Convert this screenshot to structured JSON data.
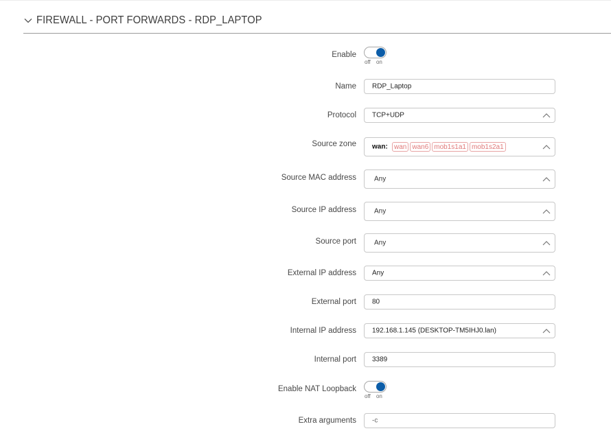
{
  "section": {
    "title": "FIREWALL - PORT FORWARDS - RDP_LAPTOP"
  },
  "form": {
    "enable": {
      "label": "Enable",
      "state": "on",
      "off_label": "off",
      "on_label": "on"
    },
    "name": {
      "label": "Name",
      "value": "RDP_Laptop"
    },
    "protocol": {
      "label": "Protocol",
      "value": "TCP+UDP"
    },
    "source_zone": {
      "label": "Source zone",
      "prefix": "wan:",
      "tags": [
        "wan",
        "wan6",
        "mob1s1a1",
        "mob1s2a1"
      ]
    },
    "source_mac": {
      "label": "Source MAC address",
      "value": "Any"
    },
    "source_ip": {
      "label": "Source IP address",
      "value": "Any"
    },
    "source_port": {
      "label": "Source port",
      "value": "Any"
    },
    "external_ip": {
      "label": "External IP address",
      "value": "Any"
    },
    "external_port": {
      "label": "External port",
      "value": "80"
    },
    "internal_ip": {
      "label": "Internal IP address",
      "value": "192.168.1.145 (DESKTOP-TM5IHJ0.lan)"
    },
    "internal_port": {
      "label": "Internal port",
      "value": "3389"
    },
    "nat_loopback": {
      "label": "Enable NAT Loopback",
      "state": "on",
      "off_label": "off",
      "on_label": "on"
    },
    "extra_arguments": {
      "label": "Extra arguments",
      "value": "-c"
    }
  },
  "colors": {
    "toggle_knob": "#0c5da8",
    "zone_tag": "#e07a7a",
    "section_rule": "#9a9a9a"
  },
  "icons": {
    "collapse": "chevron-down-icon",
    "select": "chevron-up-icon"
  }
}
